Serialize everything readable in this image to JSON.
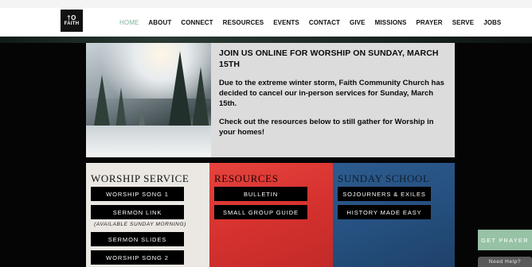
{
  "header": {
    "logo": {
      "mark": "†O",
      "word": "FAITH"
    },
    "nav": [
      {
        "label": "HOME",
        "active": true
      },
      {
        "label": "ABOUT"
      },
      {
        "label": "CONNECT"
      },
      {
        "label": "RESOURCES"
      },
      {
        "label": "EVENTS"
      },
      {
        "label": "CONTACT"
      },
      {
        "label": "GIVE"
      },
      {
        "label": "MISSIONS"
      },
      {
        "label": "PRAYER"
      },
      {
        "label": "SERVE"
      },
      {
        "label": "JOBS"
      }
    ]
  },
  "announcement": {
    "title": "JOIN US ONLINE FOR WORSHIP ON SUNDAY, MARCH 15TH",
    "paragraph1": "Due to the extreme winter storm, Faith Community Church has decided to cancel our in-person services for Sunday, March 15th.",
    "paragraph2": "Check out the resources below to still gather for Worship in your homes!",
    "image_icon": "snowy-forest-photo"
  },
  "columns": {
    "worship": {
      "title": "WORSHIP SERVICE",
      "buttons": [
        "WORSHIP SONG 1",
        "SERMON LINK",
        "SERMON SLIDES",
        "WORSHIP SONG 2"
      ],
      "note": "(AVAILABLE SUNDAY MORNING)",
      "color": "#ebe8e3"
    },
    "resources": {
      "title": "RESOURCES",
      "buttons": [
        "BULLETIN",
        "SMALL GROUP GUIDE"
      ],
      "color": "#d6322f"
    },
    "sunday": {
      "title": "SUNDAY SCHOOL",
      "buttons": [
        "SOJOURNERS & EXILES",
        "HISTORY MADE EASY"
      ],
      "color": "#254f7e"
    }
  },
  "widgets": {
    "get_prayer": "GET PRAYER",
    "need_help": "Need Help?",
    "get_prayer_color": "#97c2a5"
  }
}
